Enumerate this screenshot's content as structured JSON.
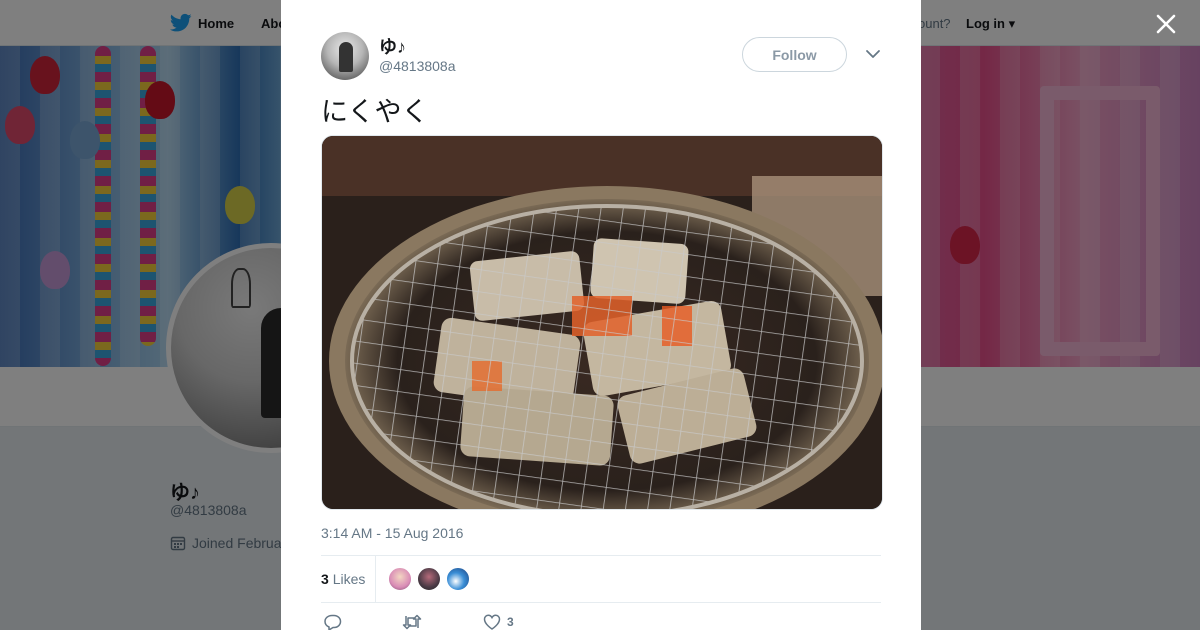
{
  "topbar": {
    "home_label": "Home",
    "about_label": "Abo",
    "account_prompt": "ccount?",
    "login_label": "Log in"
  },
  "profile": {
    "display_name": "ゆ♪",
    "handle": "@4813808a",
    "joined_text": "Joined Februa"
  },
  "tweet": {
    "author_name": "ゆ♪",
    "author_handle": "@4813808a",
    "follow_label": "Follow",
    "text": "にくやく",
    "timestamp": "3:14 AM - 15 Aug 2016",
    "likes_count": "3",
    "likes_label": "Likes",
    "like_action_count": "3"
  },
  "icons": {
    "brand": "twitter-bird-icon",
    "close": "close-icon",
    "caret": "chevron-down-icon",
    "reply": "reply-icon",
    "retweet": "retweet-icon",
    "like": "heart-icon",
    "calendar": "calendar-icon"
  },
  "colors": {
    "brand_blue": "#1da1f2",
    "text_primary": "#14171a",
    "text_secondary": "#657786",
    "border": "#e6ecf0"
  }
}
